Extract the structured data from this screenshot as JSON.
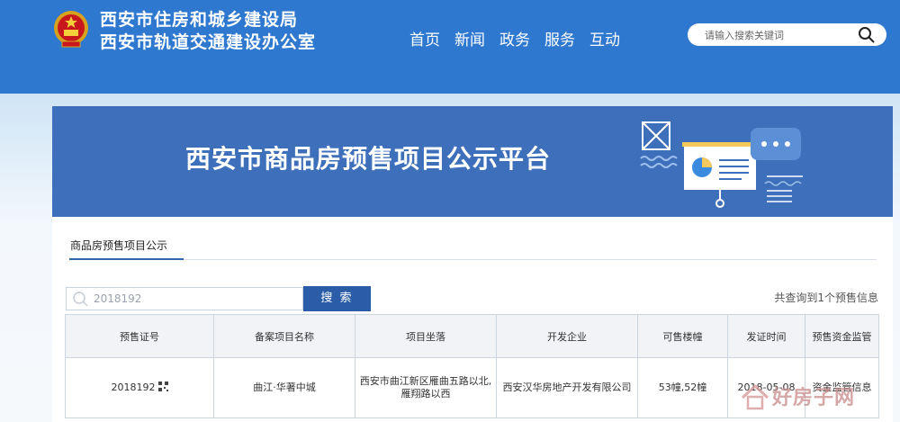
{
  "header": {
    "org_line1": "西安市住房和城乡建设局",
    "org_line2": "西安市轨道交通建设办公室",
    "nav": [
      "首页",
      "新闻",
      "政务",
      "服务",
      "互动"
    ],
    "search_placeholder": "请输入搜索关键词"
  },
  "banner": {
    "title": "西安市商品房预售项目公示平台"
  },
  "tab": {
    "label": "商品房预售项目公示"
  },
  "query": {
    "value": "2018192",
    "button_label": "搜 索",
    "result_count": "共查询到1个预售信息"
  },
  "table": {
    "headers": [
      "预售证号",
      "备案项目名称",
      "项目坐落",
      "开发企业",
      "可售楼幢",
      "发证时间",
      "预售资金监管"
    ],
    "rows": [
      {
        "cert_no": "2018192",
        "project": "曲江·华著中城",
        "location": "西安市曲江新区雁曲五路以北,雁翔路以西",
        "developer": "西安汉华房地产开发有限公司",
        "buildings": "53幢,52幢",
        "issue_date": "2018-05-08",
        "fund_supervision": "资金监管信息"
      }
    ]
  },
  "watermark": "好房子网",
  "colors": {
    "header_bg": "#2f78cf",
    "banner_bg": "#3e6fbb",
    "button_bg": "#2a5ca8"
  }
}
